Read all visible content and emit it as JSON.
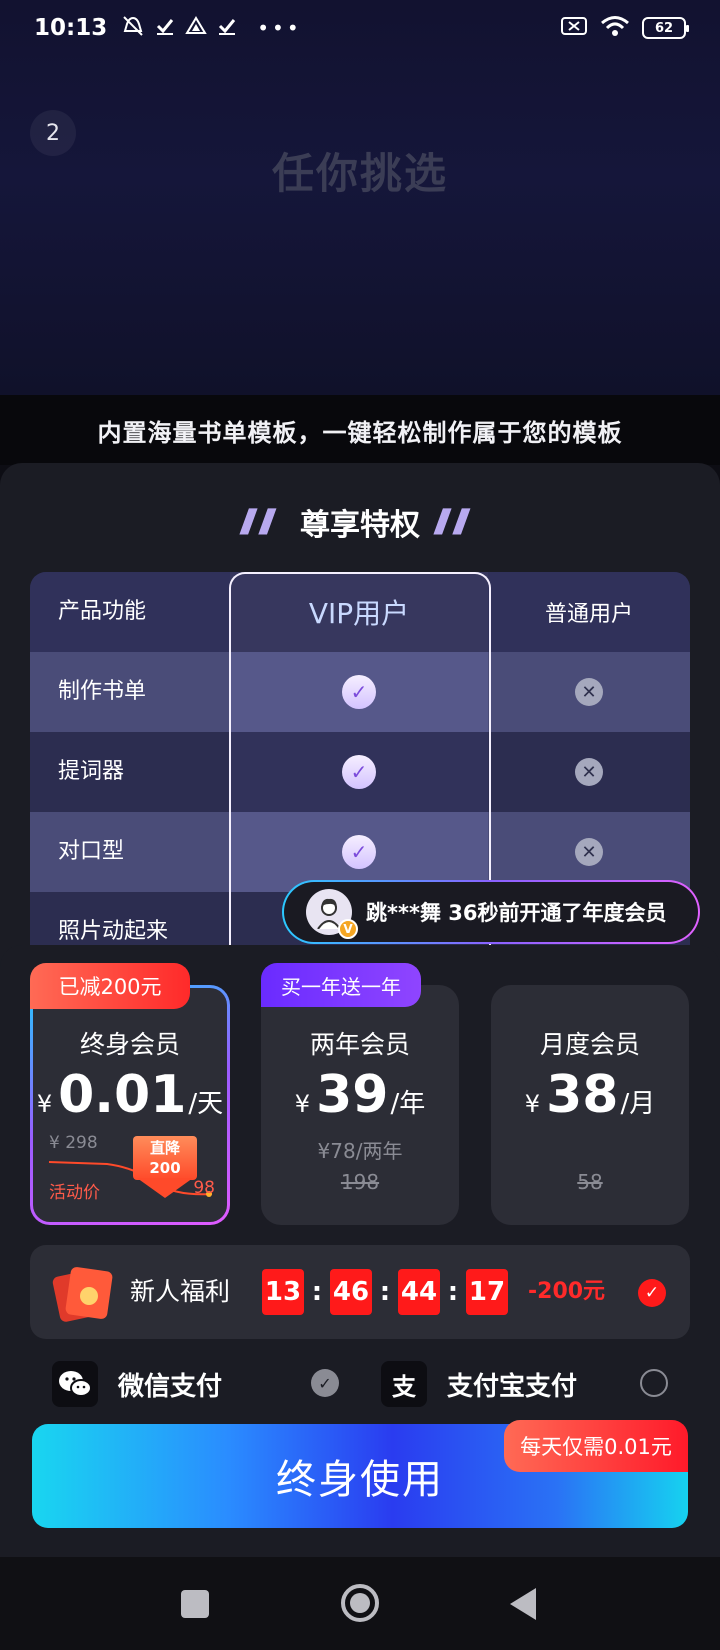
{
  "status_bar": {
    "time": "10:13",
    "icons_left": [
      "mute-icon",
      "check-icon",
      "drive-icon",
      "check-icon",
      "more-icon"
    ],
    "battery": "62"
  },
  "hero": {
    "page_indicator": "2",
    "title": "任你挑选",
    "subtitle": "内置海量书单模板，一键轻松制作属于您的模板"
  },
  "privileges": {
    "title": "尊享特权",
    "header": {
      "feature": "产品功能",
      "vip": "VIP用户",
      "normal": "普通用户"
    },
    "rows": [
      {
        "feature": "制作书单",
        "vip": true,
        "normal": false
      },
      {
        "feature": "提词器",
        "vip": true,
        "normal": false
      },
      {
        "feature": "对口型",
        "vip": true,
        "normal": false
      },
      {
        "feature": "照片动起来",
        "vip": true,
        "normal": false
      }
    ]
  },
  "toast": {
    "text": "跳***舞 36秒前开通了年度会员"
  },
  "plans": [
    {
      "badge": "已减200元",
      "name": "终身会员",
      "currency": "¥",
      "price": "0.01",
      "unit": "/天",
      "old_price": "¥ 298",
      "arrow_text_1": "直降",
      "arrow_text_2": "200",
      "activity_label": "活动价",
      "activity_price": "98"
    },
    {
      "badge": "买一年送一年",
      "name": "两年会员",
      "currency": "¥",
      "price": "39",
      "unit": "/年",
      "sub": "¥78/两年",
      "orig": "198"
    },
    {
      "name": "月度会员",
      "currency": "¥",
      "price": "38",
      "unit": "/月",
      "orig": "58"
    }
  ],
  "welfare": {
    "label": "新人福利",
    "timer": [
      "13",
      "46",
      "44",
      "17"
    ],
    "discount": "-200元"
  },
  "payment": {
    "wechat": "微信支付",
    "alipay": "支付宝支付",
    "selected": "wechat"
  },
  "cta": {
    "label": "终身使用",
    "tag": "每天仅需0.01元"
  },
  "colors": {
    "accent_red": "#ff1a1a",
    "cta_blue": "#2a3cf0",
    "cta_cyan": "#19d6f0",
    "panel": "#2c2d36"
  }
}
